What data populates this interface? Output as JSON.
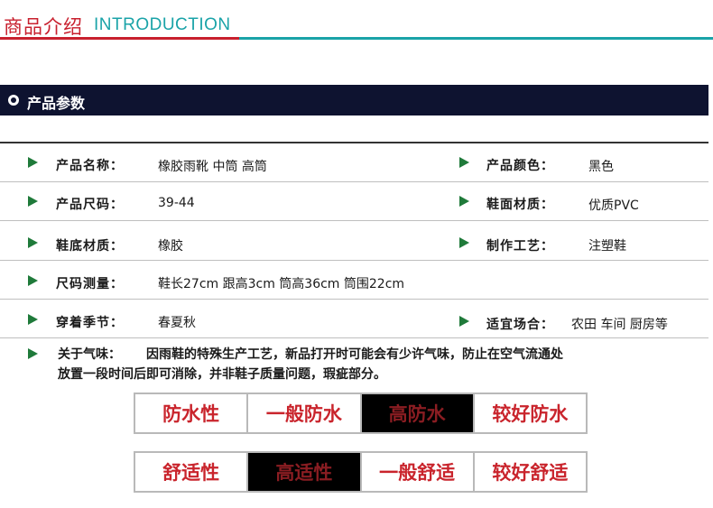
{
  "header": {
    "title_cn": "商品介绍",
    "title_en": "INTRODUCTION"
  },
  "section": {
    "title": "产品参数"
  },
  "params": [
    {
      "label": "产品名称：",
      "value": "橡胶雨靴 中筒 高筒"
    },
    {
      "label": "产品颜色：",
      "value": "黑色"
    },
    {
      "label": "产品尺码：",
      "value": "39-44"
    },
    {
      "label": "鞋面材质：",
      "value": "优质PVC"
    },
    {
      "label": "鞋底材质：",
      "value": "橡胶"
    },
    {
      "label": "制作工艺：",
      "value": "注塑鞋"
    },
    {
      "label": "尺码测量：",
      "value": "鞋长27cm 跟高3cm 筒高36cm 筒围22cm"
    },
    {
      "label": "穿着季节：",
      "value": "春夏秋"
    },
    {
      "label": "适宜场合：",
      "value": "农田 车间 厨房等"
    }
  ],
  "notice": {
    "label": "关于气味：",
    "text_line1": "因雨鞋的特殊生产工艺，新品打开时可能会有少许气味，防止在空气流通处",
    "text_line2": "放置一段时间后即可消除，并非鞋子质量问题，瑕疵部分。"
  },
  "ratings": [
    {
      "name": "防水性",
      "options": [
        "一般防水",
        "高防水",
        "较好防水"
      ],
      "selected": "高防水"
    },
    {
      "name": "舒适性",
      "options": [
        "高适性",
        "一般舒适",
        "较好舒适"
      ],
      "selected": "高适性"
    }
  ],
  "colors": {
    "header_red": "#c8202e",
    "header_teal": "#1aa3a8",
    "bar_navy": "#0e1330",
    "arrow_green": "#1f7a3a",
    "rating_red": "#c9242c",
    "rating_selected_bg": "#000000"
  }
}
